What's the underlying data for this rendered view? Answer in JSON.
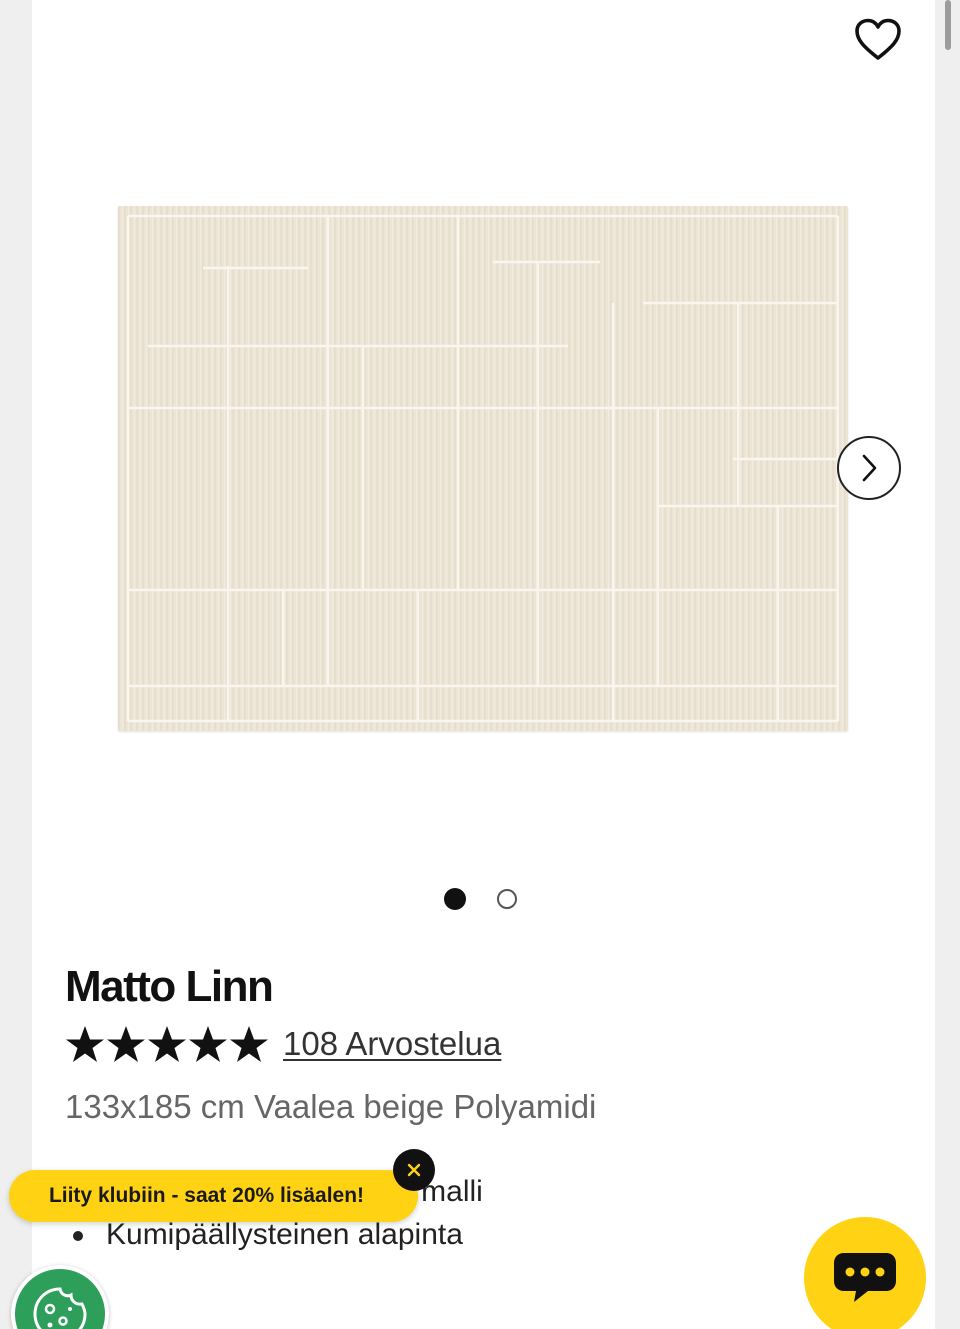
{
  "product": {
    "title": "Matto Linn",
    "rating": 5,
    "reviews_label": "108 Arvostelua",
    "subtitle": "133x185 cm Vaalea beige Polyamidi",
    "features": [
      "Dynaaminen ja leikkisä malli",
      "Kumipäällysteinen alapinta"
    ]
  },
  "gallery": {
    "image_count": 2,
    "active_index": 0
  },
  "promo": {
    "club_label": "Liity klubiin - saat 20% lisäalen!"
  },
  "icons": {
    "wishlist": "heart-icon",
    "next": "chevron-right-icon",
    "close": "close-icon",
    "chat": "chat-bubble-icon",
    "cookie": "cookie-icon",
    "star": "star-icon"
  },
  "colors": {
    "accent_yellow": "#ffd314",
    "rug_base": "#ece4d6",
    "cookie_green": "#2e9e5b"
  }
}
